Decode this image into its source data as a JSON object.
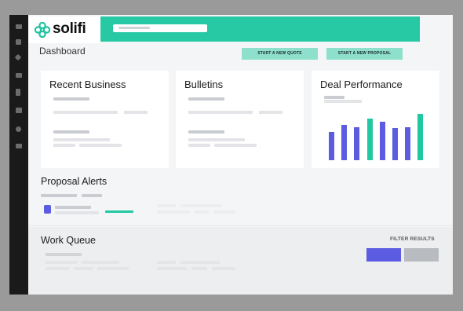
{
  "app": {
    "name": "solifi"
  },
  "header": {
    "search_placeholder": ""
  },
  "page": {
    "title": "Dashboard"
  },
  "actions": {
    "new_quote": "START A NEW QUOTE",
    "new_proposal": "START A NEW PROPOSAL"
  },
  "cards": {
    "recent_business": {
      "title": "Recent Business"
    },
    "bulletins": {
      "title": "Bulletins"
    },
    "deal_performance": {
      "title": "Deal Performance",
      "bars": [
        {
          "value": 0.52,
          "color": "#5b5ce2"
        },
        {
          "value": 0.64,
          "color": "#5b5ce2"
        },
        {
          "value": 0.6,
          "color": "#5b5ce2"
        },
        {
          "value": 0.76,
          "color": "#22c8a0"
        },
        {
          "value": 0.7,
          "color": "#5b5ce2"
        },
        {
          "value": 0.58,
          "color": "#5b5ce2"
        },
        {
          "value": 0.6,
          "color": "#5b5ce2"
        },
        {
          "value": 0.84,
          "color": "#22c8a0"
        }
      ]
    }
  },
  "proposal_alerts": {
    "title": "Proposal Alerts"
  },
  "work_queue": {
    "title": "Work Queue",
    "filter_label": "FILTER RESULTS"
  },
  "colors": {
    "accent": "#27c8a4",
    "purple": "#5b5ce2",
    "rail": "#1a1a1a",
    "gray_button": "#b8bcc0"
  },
  "icons": [
    "menu-icon",
    "grid-icon",
    "dashboard-icon",
    "list-icon",
    "document-icon",
    "apps-icon",
    "settings-icon",
    "inbox-icon"
  ]
}
